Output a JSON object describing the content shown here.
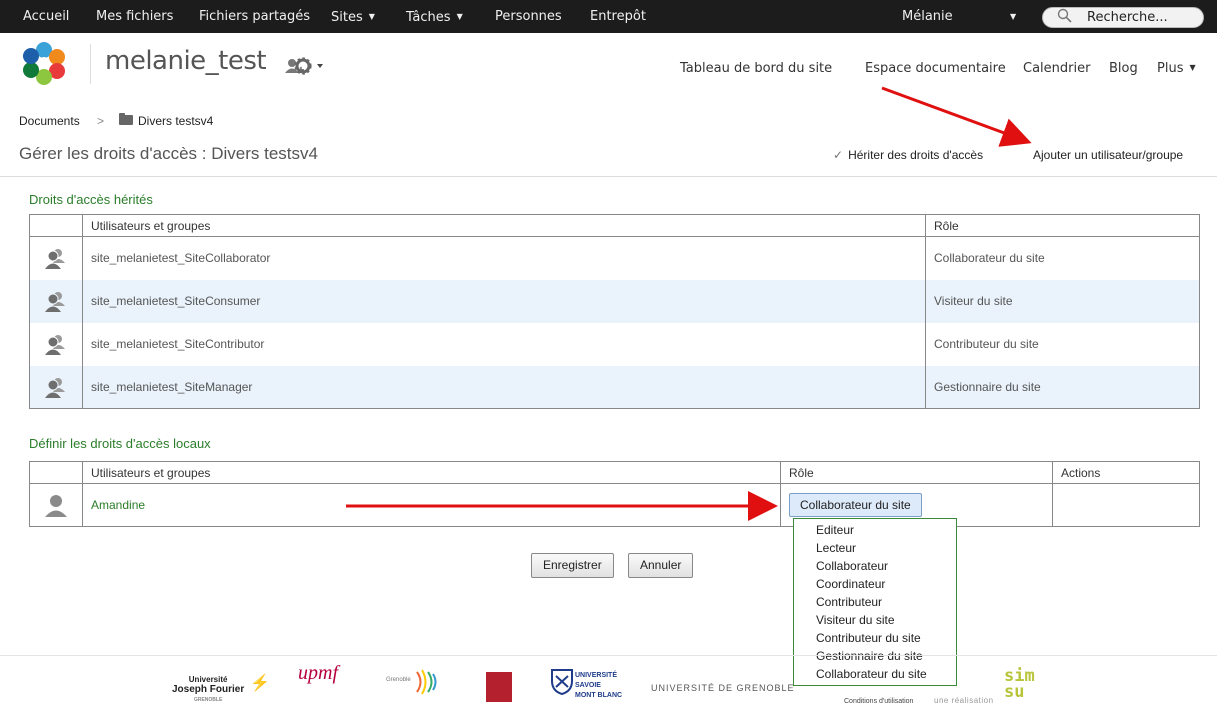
{
  "topnav": {
    "items": [
      "Accueil",
      "Mes fichiers",
      "Fichiers partagés",
      "Sites",
      "Tâches",
      "Personnes",
      "Entrepôt"
    ],
    "user": "Mélanie",
    "search_placeholder": "Recherche..."
  },
  "site": {
    "title": "melanie_test",
    "nav": [
      "Tableau de bord du site",
      "Espace documentaire",
      "Calendrier",
      "Blog",
      "Plus"
    ]
  },
  "breadcrumb": {
    "root": "Documents",
    "separator": ">",
    "folder": "Divers testsv4"
  },
  "page": {
    "title": "Gérer les droits d'accès : Divers testsv4",
    "inherit_label": "Hériter des droits d'accès",
    "add_label": "Ajouter un utilisateur/groupe"
  },
  "inherited": {
    "title": "Droits d'accès hérités",
    "col_users": "Utilisateurs et groupes",
    "col_role": "Rôle",
    "rows": [
      {
        "name": "site_melanietest_SiteCollaborator",
        "role": "Collaborateur du site"
      },
      {
        "name": "site_melanietest_SiteConsumer",
        "role": "Visiteur du site"
      },
      {
        "name": "site_melanietest_SiteContributor",
        "role": "Contributeur du site"
      },
      {
        "name": "site_melanietest_SiteManager",
        "role": "Gestionnaire du site"
      }
    ]
  },
  "local": {
    "title": "Définir les droits d'accès locaux",
    "col_users": "Utilisateurs et groupes",
    "col_role": "Rôle",
    "col_actions": "Actions",
    "row": {
      "name": "Amandine",
      "role": "Collaborateur du site"
    }
  },
  "role_options": [
    "Editeur",
    "Lecteur",
    "Collaborateur",
    "Coordinateur",
    "Contributeur",
    "Visiteur du site",
    "Contributeur du site",
    "Gestionnaire du site",
    "Collaborateur du site"
  ],
  "buttons": {
    "save": "Enregistrer",
    "cancel": "Annuler"
  },
  "footer": {
    "logos": {
      "ujf_line1": "Université",
      "ujf_line2": "Joseph Fourier",
      "ujf_line3": "GRENOBLE",
      "upmf": "upmf",
      "grenoble": "Grenoble",
      "savoie_line1": "UNIVERSITÉ",
      "savoie_line2": "SAVOIE",
      "savoie_line3": "MONT BLANC",
      "univ_grenoble": "UNIVERSITÉ DE GRENOBLE",
      "simsu_top": "sim",
      "simsu_bottom": "su"
    },
    "terms": "Conditions d'utilisation",
    "credit": "une réalisation"
  },
  "colors": {
    "topbar": "#1c1c1c",
    "section_title": "#2a7d2a",
    "alt_row": "#eaf2fb",
    "annotation_arrow": "#e01010"
  }
}
